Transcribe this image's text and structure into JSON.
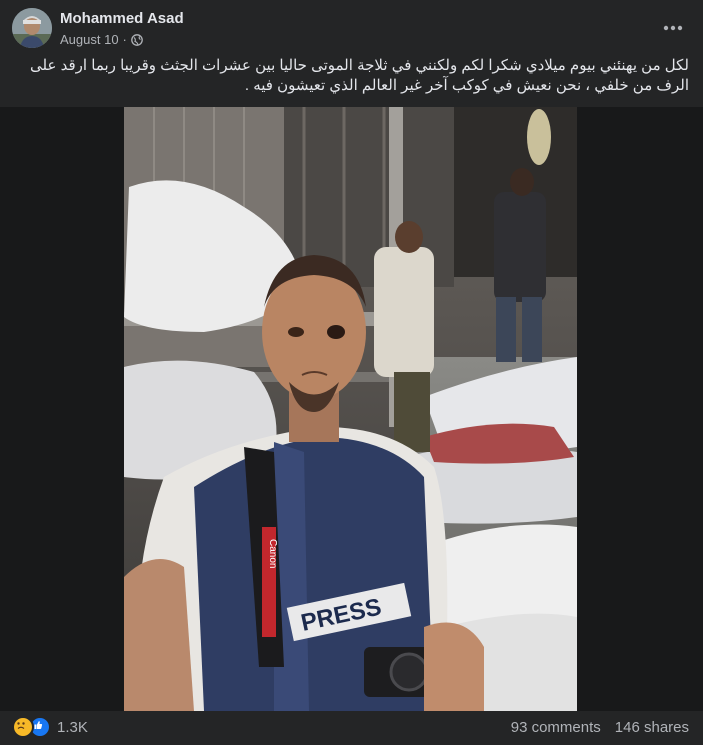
{
  "post": {
    "author": "Mohammed Asad",
    "date": "August 10",
    "separator": "·",
    "privacy_icon": "globe-icon",
    "more_icon": "more-options-icon",
    "caption": "لكل من يهنئني بيوم ميلادي شكرا لكم ولكنني في ثلاجة الموتى حاليا بين عشرات الجثث وقريبا ربما ارقد على الرف من خلفي ، نحن نعيش في كوكب آخر غير العالم الذي تعيشون فيه .",
    "photo_text": {
      "vest_label": "PRESS",
      "strap_brand": "Canon"
    }
  },
  "footer": {
    "reaction_icons": [
      "sad-icon",
      "like-icon"
    ],
    "reaction_count": "1.3K",
    "comments": "93 comments",
    "shares": "146 shares"
  },
  "colors": {
    "background": "#242526",
    "media_background": "#18191a",
    "primary_text": "#e4e6eb",
    "secondary_text": "#b0b3b8",
    "like_blue": "#1877f2",
    "sad_yellow": "#f7b928"
  }
}
